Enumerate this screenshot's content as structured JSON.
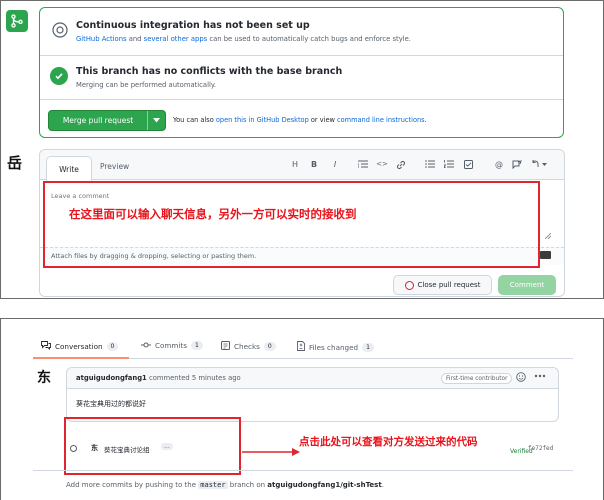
{
  "merge_box": {
    "ci_title": "Continuous integration has not been set up",
    "ci_link1": "GitHub Actions",
    "ci_and": " and ",
    "ci_link2": "several other apps",
    "ci_tail": " can be used to automatically catch bugs and enforce style.",
    "ok_title": "This branch has no conflicts with the base branch",
    "ok_sub": "Merging can be performed automatically.",
    "merge_button": "Merge pull request",
    "also_prefix": "You can also ",
    "also_link1": "open this in GitHub Desktop",
    "also_mid": " or view ",
    "also_link2": "command line instructions",
    "also_end": "."
  },
  "editor": {
    "avatar": "岳",
    "tab_write": "Write",
    "tab_preview": "Preview",
    "toolbar": [
      "H",
      "B",
      "I",
      "☰",
      "<>",
      "🔗",
      "☰",
      "☰",
      "☑",
      "@",
      "↗",
      "↶"
    ],
    "placeholder": "Leave a comment",
    "annotation": "在这里面可以输入聊天信息，另外一方可以实时的接收到",
    "attach": "Attach files by dragging & dropping, selecting or pasting them.",
    "close_button": "Close pull request",
    "comment_button": "Comment"
  },
  "conversation": {
    "tabs": [
      {
        "label": "Conversation",
        "count": "0"
      },
      {
        "label": "Commits",
        "count": "1"
      },
      {
        "label": "Checks",
        "count": "0"
      },
      {
        "label": "Files changed",
        "count": "1"
      }
    ],
    "avatar": "东",
    "author": "atguigudongfang1",
    "commented": " commented 5 minutes ago",
    "badge": "First-time contributor",
    "body": "葵花宝典用过的都说好",
    "commit_avatar": "东",
    "commit_msg": "葵花宝典讨论组",
    "commit_more": "...",
    "annotation": "点击此处可以查看对方发送过来的代码",
    "verified": "Verified",
    "sha": "fe72fed",
    "addmore_prefix": "Add more commits by pushing to the ",
    "addmore_branch": "master",
    "addmore_mid": " branch on ",
    "addmore_repo": "atguigudongfang1/git-shTest",
    "addmore_end": "."
  },
  "colors": {
    "green": "#2da44e",
    "red_annotation": "#e0252e",
    "link": "#0969da"
  }
}
